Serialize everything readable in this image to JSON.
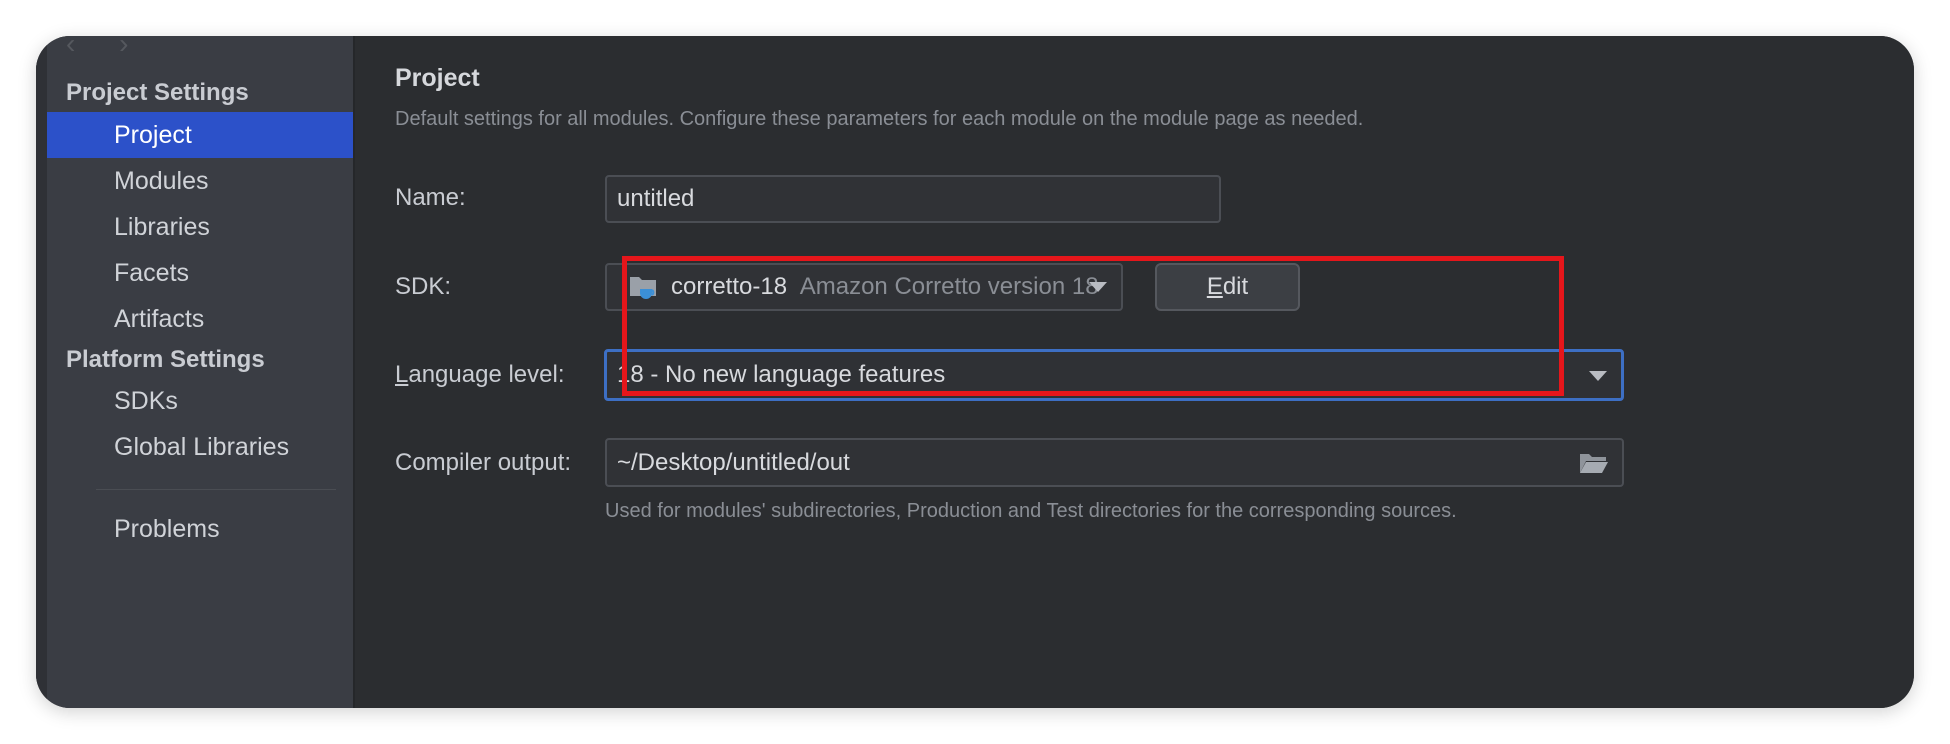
{
  "sidebar": {
    "nav_arrows": "‹ ›",
    "project_settings_header": "Project Settings",
    "platform_settings_header": "Platform Settings",
    "items": [
      {
        "label": "Project",
        "selected": true
      },
      {
        "label": "Modules"
      },
      {
        "label": "Libraries"
      },
      {
        "label": "Facets"
      },
      {
        "label": "Artifacts"
      }
    ],
    "platform_items": [
      {
        "label": "SDKs"
      },
      {
        "label": "Global Libraries"
      }
    ],
    "problems_label": "Problems"
  },
  "main": {
    "title": "Project",
    "description": "Default settings for all modules. Configure these parameters for each module on the module page as needed.",
    "name_label": "Name:",
    "name_value": "untitled",
    "sdk_label": "SDK:",
    "sdk_value": "corretto-18",
    "sdk_detail": "Amazon Corretto version 18",
    "sdk_icon": "folder-java-icon",
    "edit_button_first": "E",
    "edit_button_rest": "dit",
    "language_label_first": "L",
    "language_label_rest": "anguage level:",
    "language_value": "18 - No new language features",
    "compiler_label": "Compiler output:",
    "compiler_value": "~/Desktop/untitled/out",
    "compiler_hint": "Used for modules' subdirectories, Production and Test directories for the corresponding sources."
  },
  "colors": {
    "selection": "#2c51c9",
    "highlight_box": "#e5161b",
    "background": "#2b2d30",
    "sidebar": "#3a3d44"
  }
}
